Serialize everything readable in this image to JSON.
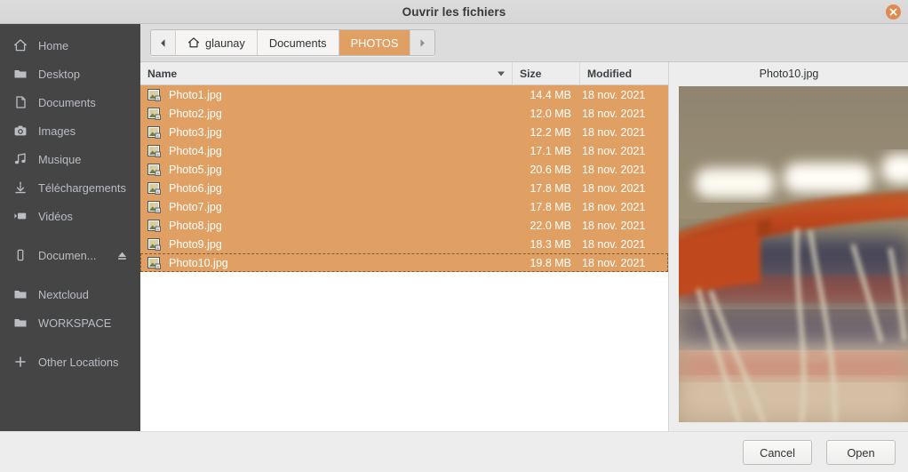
{
  "window": {
    "title": "Ouvrir les fichiers",
    "close_icon": "close-icon",
    "accent_color": "#e1a063",
    "sidebar_bg": "#454545"
  },
  "sidebar": {
    "items": [
      {
        "label": "Home",
        "icon": "home-icon"
      },
      {
        "label": "Desktop",
        "icon": "folder-icon"
      },
      {
        "label": "Documents",
        "icon": "document-icon"
      },
      {
        "label": "Images",
        "icon": "camera-icon"
      },
      {
        "label": "Musique",
        "icon": "music-icon"
      },
      {
        "label": "Téléchargements",
        "icon": "download-icon"
      },
      {
        "label": "Vidéos",
        "icon": "video-icon"
      }
    ],
    "devices": [
      {
        "label": "Documen...",
        "icon": "drive-icon",
        "eject_icon": "eject-icon"
      }
    ],
    "bookmarks": [
      {
        "label": "Nextcloud",
        "icon": "folder-icon"
      },
      {
        "label": "WORKSPACE",
        "icon": "folder-icon"
      }
    ],
    "other": {
      "label": "Other Locations",
      "icon": "plus-icon"
    }
  },
  "pathbar": {
    "back_icon": "chevron-left-icon",
    "forward_icon": "chevron-right-icon",
    "crumbs": [
      {
        "label": "glaunay",
        "icon": "home-icon",
        "active": false
      },
      {
        "label": "Documents",
        "icon": "",
        "active": false
      },
      {
        "label": "PHOTOS",
        "icon": "",
        "active": true
      }
    ]
  },
  "filelist": {
    "columns": [
      {
        "key": "name",
        "label": "Name",
        "sorted": true,
        "sort_icon": "sort-descending-icon"
      },
      {
        "key": "size",
        "label": "Size",
        "sorted": false
      },
      {
        "key": "modified",
        "label": "Modified",
        "sorted": false
      }
    ],
    "rows": [
      {
        "name": "Photo1.jpg",
        "size": "14.4 MB",
        "modified": "18 nov. 2021",
        "icon": "image-file-icon",
        "selected": true,
        "focused": false
      },
      {
        "name": "Photo2.jpg",
        "size": "12.0 MB",
        "modified": "18 nov. 2021",
        "icon": "image-file-icon",
        "selected": true,
        "focused": false
      },
      {
        "name": "Photo3.jpg",
        "size": "12.2 MB",
        "modified": "18 nov. 2021",
        "icon": "image-file-icon",
        "selected": true,
        "focused": false
      },
      {
        "name": "Photo4.jpg",
        "size": "17.1 MB",
        "modified": "18 nov. 2021",
        "icon": "image-file-icon",
        "selected": true,
        "focused": false
      },
      {
        "name": "Photo5.jpg",
        "size": "20.6 MB",
        "modified": "18 nov. 2021",
        "icon": "image-file-icon",
        "selected": true,
        "focused": false
      },
      {
        "name": "Photo6.jpg",
        "size": "17.8 MB",
        "modified": "18 nov. 2021",
        "icon": "image-file-icon",
        "selected": true,
        "focused": false
      },
      {
        "name": "Photo7.jpg",
        "size": "17.8 MB",
        "modified": "18 nov. 2021",
        "icon": "image-file-icon",
        "selected": true,
        "focused": false
      },
      {
        "name": "Photo8.jpg",
        "size": "22.0 MB",
        "modified": "18 nov. 2021",
        "icon": "image-file-icon",
        "selected": true,
        "focused": false
      },
      {
        "name": "Photo9.jpg",
        "size": "18.3 MB",
        "modified": "18 nov. 2021",
        "icon": "image-file-icon",
        "selected": true,
        "focused": false
      },
      {
        "name": "Photo10.jpg",
        "size": "19.8 MB",
        "modified": "18 nov. 2021",
        "icon": "image-file-icon",
        "selected": true,
        "focused": true
      }
    ]
  },
  "preview": {
    "filename": "Photo10.jpg",
    "image_description": "close-up photograph of an orange basketball hoop rim with white net against a blurred gym background"
  },
  "footer": {
    "cancel_label": "Cancel",
    "open_label": "Open"
  }
}
